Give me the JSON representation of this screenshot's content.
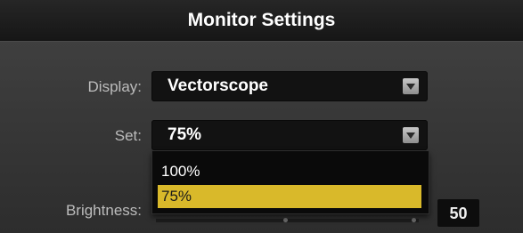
{
  "header": {
    "title": "Monitor Settings"
  },
  "fields": {
    "display": {
      "label": "Display:",
      "value": "Vectorscope"
    },
    "set": {
      "label": "Set:",
      "value": "75%"
    },
    "brightness": {
      "label": "Brightness:",
      "value": "50"
    }
  },
  "dropdown": {
    "options": [
      "100%",
      "75%"
    ],
    "selected": "75%"
  },
  "colors": {
    "accent": "#d9b92a",
    "field_bg": "#121212"
  }
}
